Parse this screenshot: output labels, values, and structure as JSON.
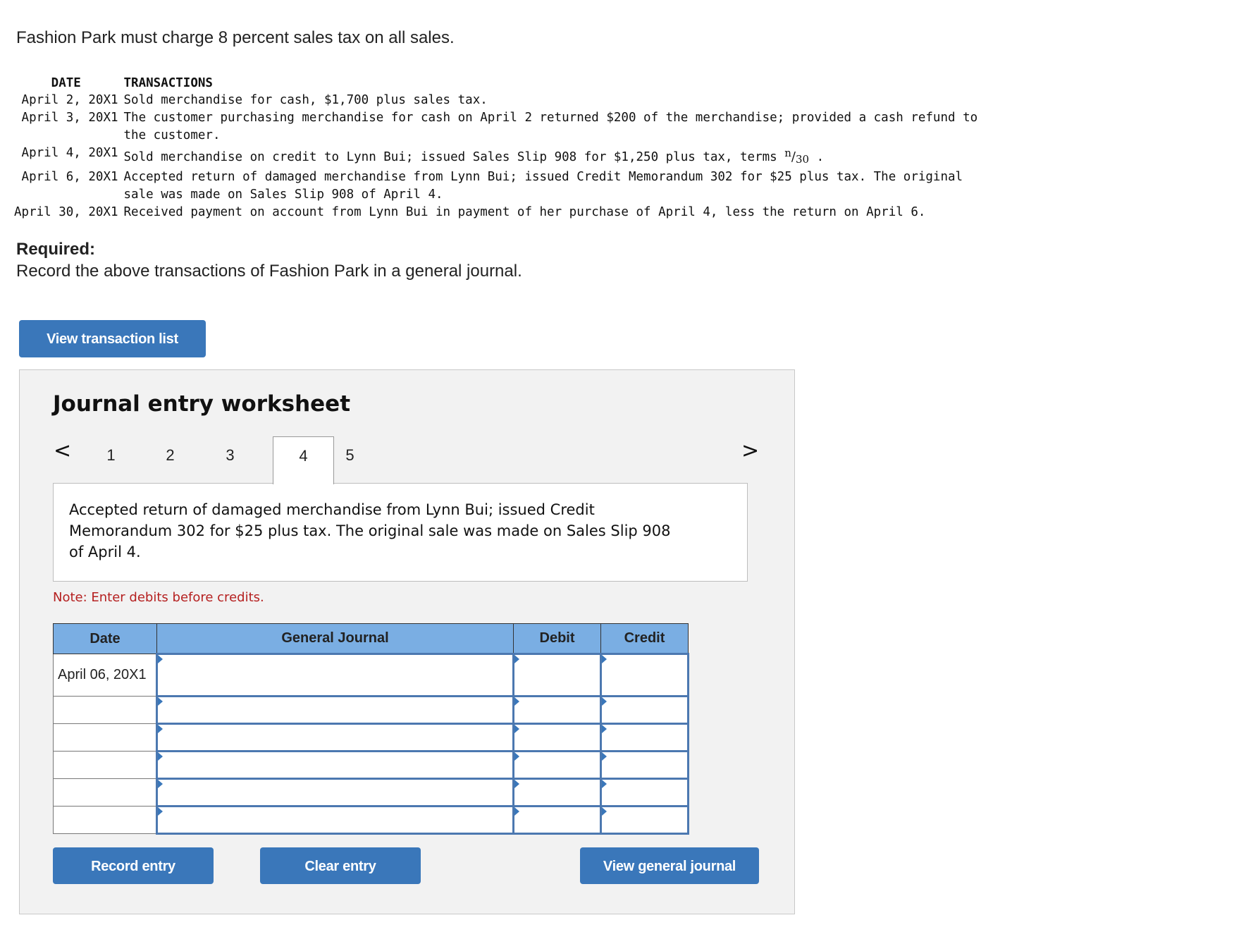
{
  "intro": "Fashion Park must charge 8 percent sales tax on all sales.",
  "transactions": {
    "headers": {
      "date": "DATE",
      "transactions": "TRANSACTIONS"
    },
    "rows": [
      {
        "date": "April 2, 20X1",
        "text": "Sold merchandise for cash, $1,700 plus sales tax."
      },
      {
        "date": "April 3, 20X1",
        "text": "The customer purchasing merchandise for cash on April 2 returned $200 of the merchandise; provided a cash refund to the customer."
      },
      {
        "date": "April 4, 20X1",
        "text": "Sold merchandise on credit to Lynn Bui; issued Sales Slip 908 for $1,250 plus tax, terms",
        "terms_num": "n",
        "terms_den": "30",
        "suffix": " ."
      },
      {
        "date": "April 6, 20X1",
        "text": "Accepted return of damaged merchandise from Lynn Bui; issued Credit Memorandum 302 for $25 plus tax. The original sale was made on Sales Slip 908 of April 4."
      },
      {
        "date": "April 30, 20X1",
        "text": "Received payment on account from Lynn Bui in payment of her purchase of April 4, less the return on April 6."
      }
    ]
  },
  "required": {
    "title": "Required:",
    "text": "Record the above transactions of Fashion Park in a general journal."
  },
  "buttons": {
    "view_transaction_list": "View transaction list",
    "record_entry": "Record entry",
    "clear_entry": "Clear entry",
    "view_general_journal": "View general journal"
  },
  "worksheet": {
    "title": "Journal entry worksheet",
    "prev_icon": "<",
    "next_icon": ">",
    "tabs": [
      "1",
      "2",
      "3",
      "4",
      "5"
    ],
    "active_tab": "4",
    "description": "Accepted return of damaged merchandise from Lynn Bui; issued Credit Memorandum 302 for $25 plus tax. The original sale was made on Sales Slip 908 of April 4.",
    "note": "Note: Enter debits before credits.",
    "table": {
      "headers": {
        "date": "Date",
        "general_journal": "General Journal",
        "debit": "Debit",
        "credit": "Credit"
      },
      "rows": [
        {
          "date": "April 06, 20X1",
          "account": "",
          "debit": "",
          "credit": ""
        },
        {
          "date": "",
          "account": "",
          "debit": "",
          "credit": ""
        },
        {
          "date": "",
          "account": "",
          "debit": "",
          "credit": ""
        },
        {
          "date": "",
          "account": "",
          "debit": "",
          "credit": ""
        },
        {
          "date": "",
          "account": "",
          "debit": "",
          "credit": ""
        },
        {
          "date": "",
          "account": "",
          "debit": "",
          "credit": ""
        }
      ]
    }
  },
  "colors": {
    "button_blue": "#3a77ba",
    "table_header_blue": "#7aaee3",
    "note_red": "#b52020",
    "panel_bg": "#f2f2f2"
  }
}
